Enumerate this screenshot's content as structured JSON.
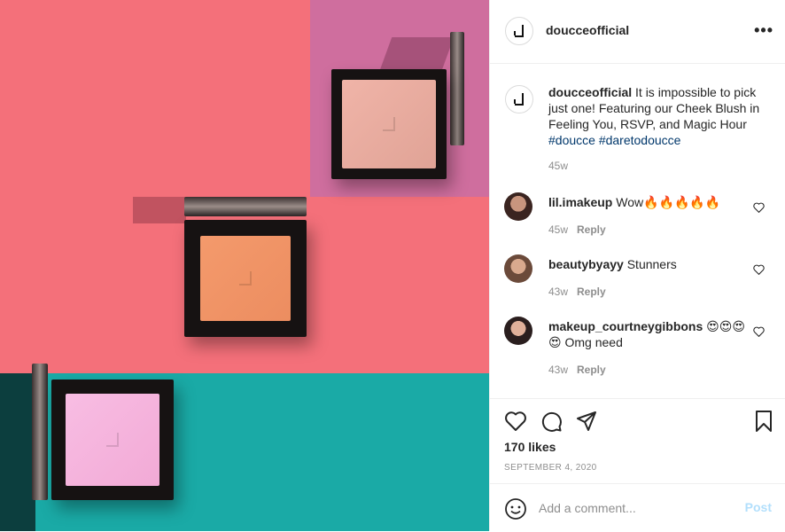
{
  "post": {
    "username": "doucceofficial",
    "more_icon": "ellipsis-icon",
    "caption": {
      "username": "doucceofficial",
      "text": " It is impossible to pick just one! Featuring our Cheek Blush in Feeling You, RSVP, and Magic Hour ",
      "hashtags": [
        "#doucce",
        "#daretodoucce"
      ],
      "time": "45w"
    },
    "comments": [
      {
        "username": "lil.imakeup",
        "text": " Wow🔥🔥🔥🔥🔥",
        "time": "45w",
        "reply": "Reply"
      },
      {
        "username": "beautybyayy",
        "text": " Stunners",
        "time": "43w",
        "reply": "Reply"
      },
      {
        "username": "makeup_courtneygibbons",
        "text": " 😍😍😍😍 Omg need",
        "time": "43w",
        "reply": "Reply"
      }
    ],
    "likes": "170 likes",
    "date": "SEPTEMBER 4, 2020",
    "add_comment": {
      "placeholder": "Add a comment...",
      "post_label": "Post"
    },
    "colors": {
      "accent_link": "#00376b",
      "post_button": "#b2dffc",
      "muted": "#8e8e8e",
      "photo_pink": "#f4707a",
      "photo_mauve": "#cf6e9e",
      "photo_teal": "#1aaaa6",
      "blush_peach": "#f0956a",
      "blush_nude": "#e8aca0",
      "blush_pink": "#f5b3dc"
    }
  }
}
